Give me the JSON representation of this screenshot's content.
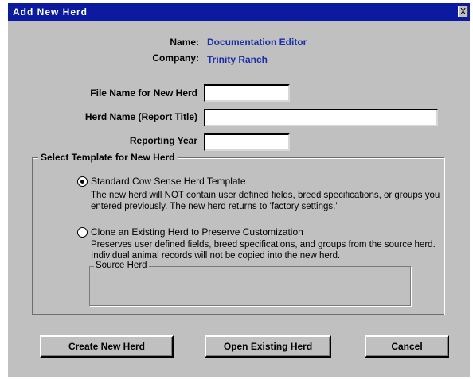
{
  "window": {
    "title": "Add New Herd",
    "close_label": "X"
  },
  "info": {
    "name_label": "Name:",
    "name_value": "Documentation Editor",
    "company_label": "Company:",
    "company_value": "Trinity Ranch"
  },
  "fields": {
    "file_name_label": "File Name for New Herd",
    "file_name_value": "",
    "herd_name_label": "Herd Name (Report Title)",
    "herd_name_value": "",
    "reporting_year_label": "Reporting Year",
    "reporting_year_value": ""
  },
  "template_group": {
    "legend": "Select Template for New Herd",
    "option1_label": "Standard Cow Sense Herd Template",
    "option1_desc": "The new herd will NOT contain user defined fields, breed specifications, or groups you entered previously. The new herd returns to 'factory settings.'",
    "option1_selected": true,
    "option2_label": "Clone an Existing Herd to Preserve Customization",
    "option2_desc": "Preserves user defined fields, breed specifications, and groups from the source herd. Individual animal records will not be copied into the new herd.",
    "option2_selected": false,
    "source_herd_legend": "Source Herd"
  },
  "buttons": {
    "create": "Create New Herd",
    "open": "Open Existing Herd",
    "cancel": "Cancel"
  }
}
